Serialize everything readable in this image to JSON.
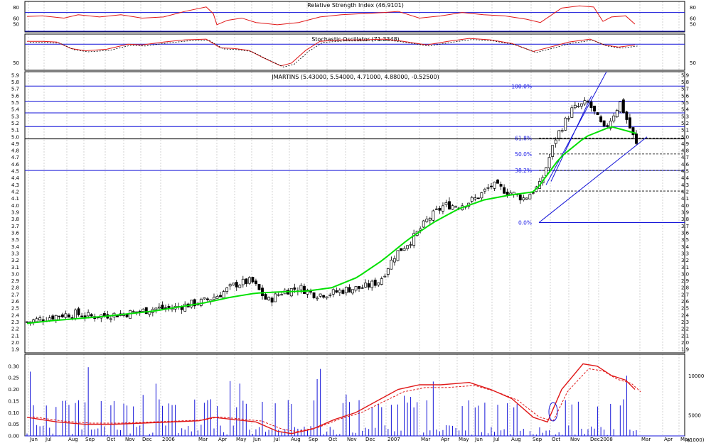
{
  "colors": {
    "blue": "#1414d8",
    "red": "#e01818",
    "green": "#00e000",
    "grid": "#c8c8c8",
    "bg": "#ffffff"
  },
  "rsi": {
    "title": "Relative Strength Index (46.9101)",
    "ticks": [
      "80",
      "60",
      "50"
    ]
  },
  "stoch": {
    "title": "Stochastic Oscillator (71.3348)",
    "ticks": [
      "50"
    ]
  },
  "price": {
    "title": "JMARTINS (5.43000, 5.54000, 4.71000, 4.88000, -0.52500)",
    "ticks": [
      "5.9",
      "5.8",
      "5.7",
      "5.6",
      "5.5",
      "5.4",
      "5.3",
      "5.2",
      "5.1",
      "5.0",
      "4.9",
      "4.8",
      "4.7",
      "4.6",
      "4.5",
      "4.4",
      "4.3",
      "4.2",
      "4.1",
      "4.0",
      "3.9",
      "3.8",
      "3.7",
      "3.6",
      "3.5",
      "3.4",
      "3.3",
      "3.2",
      "3.1",
      "3.0",
      "2.9",
      "2.8",
      "2.7",
      "2.6",
      "2.5",
      "2.4",
      "2.3",
      "2.2",
      "2.1",
      "2.0",
      "1.9"
    ],
    "fib_labels": [
      "100.0%",
      "61.8%",
      "50.0%",
      "38.2%",
      "0.0%"
    ]
  },
  "volume": {
    "left_ticks": [
      "0.30",
      "0.25",
      "0.20",
      "0.15",
      "0.10",
      "0.05",
      "0.00"
    ],
    "right_ticks": [
      "10000",
      "5000"
    ],
    "unit": "(x1000)"
  },
  "xaxis": {
    "labels": [
      "Jun",
      "Jul",
      "Aug",
      "Sep",
      "Oct",
      "Nov",
      "Dec",
      "2006",
      "Mar",
      "Apr",
      "May",
      "Jun",
      "Jul",
      "Aug",
      "Sep",
      "Oct",
      "Nov",
      "Dec",
      "2007",
      "Mar",
      "Apr",
      "May",
      "Jun",
      "Jul",
      "Aug",
      "Sep",
      "Oct",
      "Nov",
      "Dec",
      "2008",
      "Mar",
      "Apr",
      "May"
    ]
  },
  "chart_data": {
    "type": "candlestick",
    "price_ylim": [
      1.85,
      5.95
    ],
    "fibonacci": {
      "0.0%": 3.75,
      "38.2%": 4.51,
      "50.0%": 4.75,
      "61.8%": 4.98,
      "100.0%": 5.74
    },
    "close_approx": [
      2.3,
      2.35,
      2.4,
      2.42,
      2.38,
      2.4,
      2.42,
      2.45,
      2.5,
      2.5,
      2.55,
      2.6,
      2.7,
      2.85,
      2.9,
      2.6,
      2.75,
      2.8,
      2.7,
      2.72,
      2.78,
      2.8,
      2.9,
      3.3,
      3.5,
      3.8,
      4.0,
      4.0,
      4.1,
      4.3,
      4.2,
      4.1,
      4.3,
      5.0,
      5.4,
      5.5,
      5.1,
      5.5,
      4.88
    ],
    "ma_approx": [
      2.28,
      2.32,
      2.35,
      2.38,
      2.42,
      2.46,
      2.52,
      2.58,
      2.66,
      2.72,
      2.74,
      2.75,
      2.8,
      2.95,
      3.2,
      3.5,
      3.75,
      3.95,
      4.08,
      4.15,
      4.2,
      4.7,
      5.0,
      5.15,
      5.05
    ],
    "rsi_last": 46.9101,
    "stoch_last": 71.3348
  }
}
